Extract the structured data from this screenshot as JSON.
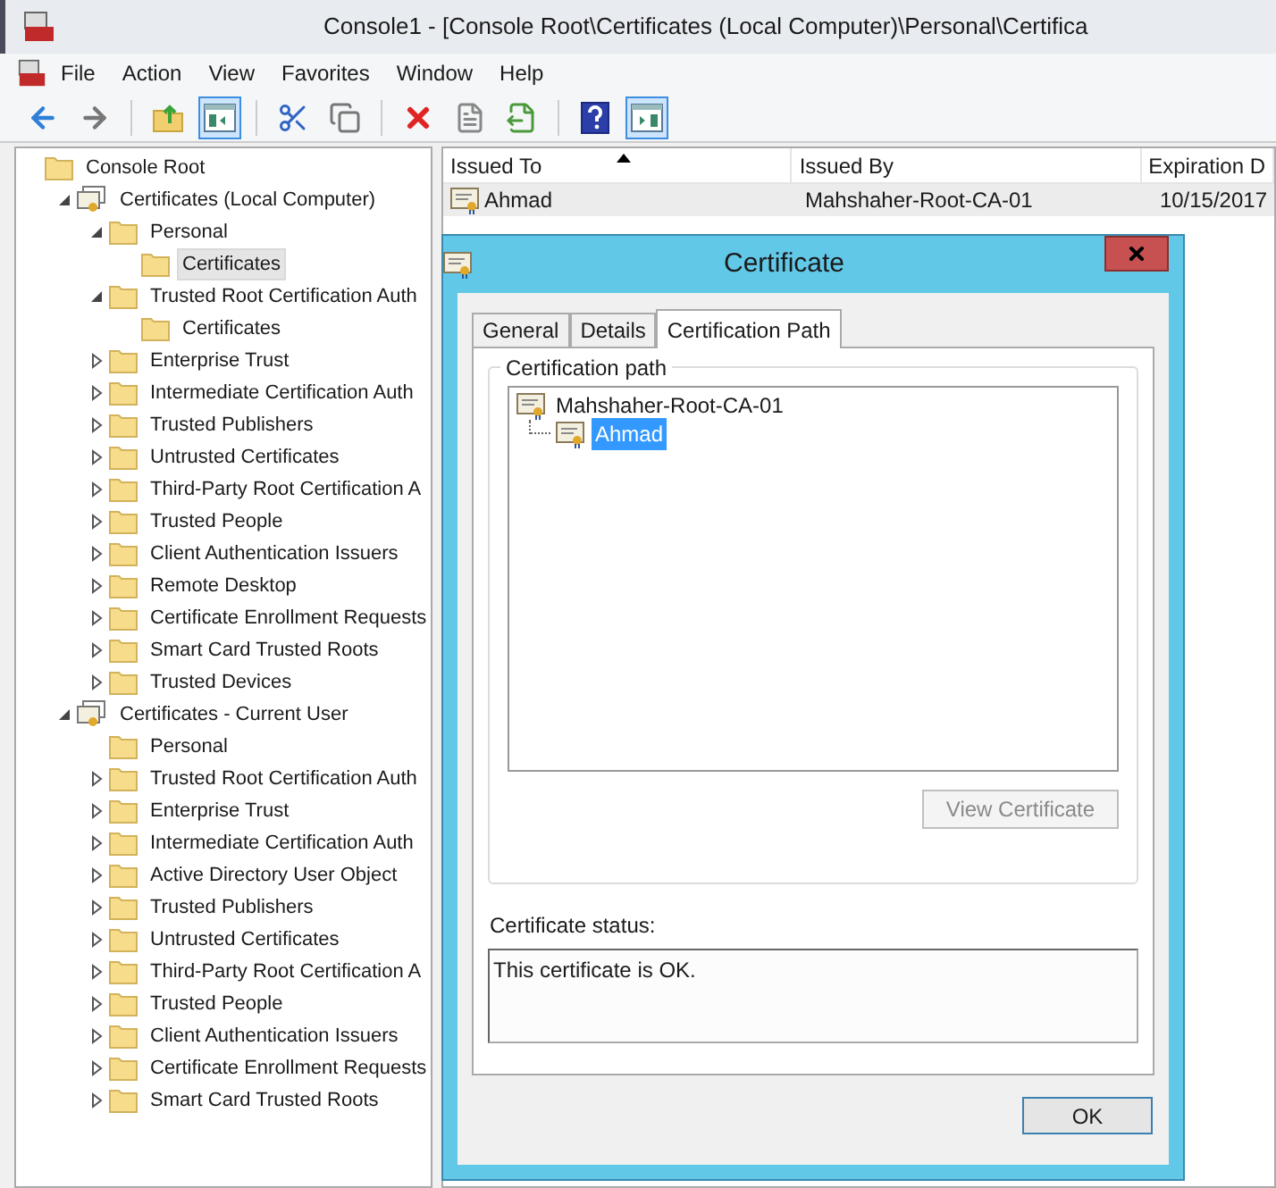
{
  "window": {
    "title": "Console1 - [Console Root\\Certificates (Local Computer)\\Personal\\Certifica"
  },
  "menu": [
    "File",
    "Action",
    "View",
    "Favorites",
    "Window",
    "Help"
  ],
  "toolbar": [
    [
      {
        "kind": "back",
        "pressed": false
      },
      {
        "kind": "forward",
        "pressed": false
      }
    ],
    [
      {
        "kind": "up",
        "pressed": false
      },
      {
        "kind": "tree",
        "pressed": true
      }
    ],
    [
      {
        "kind": "cut",
        "pressed": false
      },
      {
        "kind": "copy",
        "pressed": false
      }
    ],
    [
      {
        "kind": "delete",
        "pressed": false
      },
      {
        "kind": "properties",
        "pressed": false
      },
      {
        "kind": "export",
        "pressed": false
      }
    ],
    [
      {
        "kind": "help",
        "pressed": false
      },
      {
        "kind": "actionpane",
        "pressed": true
      }
    ]
  ],
  "tree": [
    {
      "label": "Console Root",
      "kind": "folder",
      "selected": false,
      "children": [
        {
          "label": "Certificates (Local Computer)",
          "kind": "store",
          "expanded": true,
          "selected": false,
          "children": [
            {
              "label": "Personal",
              "kind": "folder",
              "expanded": true,
              "selected": false,
              "children": [
                {
                  "label": "Certificates",
                  "kind": "folder",
                  "selected": true
                }
              ]
            },
            {
              "label": "Trusted Root Certification Auth",
              "kind": "folder",
              "expanded": true,
              "selected": false,
              "children": [
                {
                  "label": "Certificates",
                  "kind": "folder",
                  "selected": false
                }
              ]
            },
            {
              "label": "Enterprise Trust",
              "kind": "folder",
              "expanded": false,
              "selected": false
            },
            {
              "label": "Intermediate Certification Auth",
              "kind": "folder",
              "expanded": false,
              "selected": false
            },
            {
              "label": "Trusted Publishers",
              "kind": "folder",
              "expanded": false,
              "selected": false
            },
            {
              "label": "Untrusted Certificates",
              "kind": "folder",
              "expanded": false,
              "selected": false
            },
            {
              "label": "Third-Party Root Certification A",
              "kind": "folder",
              "expanded": false,
              "selected": false
            },
            {
              "label": "Trusted People",
              "kind": "folder",
              "expanded": false,
              "selected": false
            },
            {
              "label": "Client Authentication Issuers",
              "kind": "folder",
              "expanded": false,
              "selected": false
            },
            {
              "label": "Remote Desktop",
              "kind": "folder",
              "expanded": false,
              "selected": false
            },
            {
              "label": "Certificate Enrollment Requests",
              "kind": "folder",
              "expanded": false,
              "selected": false
            },
            {
              "label": "Smart Card Trusted Roots",
              "kind": "folder",
              "expanded": false,
              "selected": false
            },
            {
              "label": "Trusted Devices",
              "kind": "folder",
              "expanded": false,
              "selected": false
            }
          ]
        },
        {
          "label": "Certificates - Current User",
          "kind": "store",
          "expanded": true,
          "selected": false,
          "children": [
            {
              "label": "Personal",
              "kind": "folder",
              "selected": false
            },
            {
              "label": "Trusted Root Certification Auth",
              "kind": "folder",
              "expanded": false,
              "selected": false
            },
            {
              "label": "Enterprise Trust",
              "kind": "folder",
              "expanded": false,
              "selected": false
            },
            {
              "label": "Intermediate Certification Auth",
              "kind": "folder",
              "expanded": false,
              "selected": false
            },
            {
              "label": "Active Directory User Object",
              "kind": "folder",
              "expanded": false,
              "selected": false
            },
            {
              "label": "Trusted Publishers",
              "kind": "folder",
              "expanded": false,
              "selected": false
            },
            {
              "label": "Untrusted Certificates",
              "kind": "folder",
              "expanded": false,
              "selected": false
            },
            {
              "label": "Third-Party Root Certification A",
              "kind": "folder",
              "expanded": false,
              "selected": false
            },
            {
              "label": "Trusted People",
              "kind": "folder",
              "expanded": false,
              "selected": false
            },
            {
              "label": "Client Authentication Issuers",
              "kind": "folder",
              "expanded": false,
              "selected": false
            },
            {
              "label": "Certificate Enrollment Requests",
              "kind": "folder",
              "expanded": false,
              "selected": false
            },
            {
              "label": "Smart Card Trusted Roots",
              "kind": "folder",
              "expanded": false,
              "selected": false
            }
          ]
        }
      ]
    }
  ],
  "table": {
    "columns": [
      {
        "label": "Issued To",
        "sorted": true
      },
      {
        "label": "Issued By",
        "sorted": false
      },
      {
        "label": "Expiration D",
        "sorted": false
      }
    ],
    "rows": [
      {
        "cells": [
          "Ahmad",
          "Mahshaher-Root-CA-01",
          "10/15/2017"
        ],
        "selected": true
      }
    ]
  },
  "dialog": {
    "title": "Certificate",
    "tabs": [
      {
        "label": "General",
        "selected": false
      },
      {
        "label": "Details",
        "selected": false
      },
      {
        "label": "Certification Path",
        "selected": true
      }
    ],
    "group_label": "Certification path",
    "path": [
      {
        "label": "Mahshaher-Root-CA-01",
        "selected": false,
        "children": [
          {
            "label": "Ahmad",
            "selected": true
          }
        ]
      }
    ],
    "view_button": {
      "label": "View Certificate",
      "disabled": true
    },
    "status_label": "Certificate status:",
    "status_text": "This certificate is OK.",
    "ok_button": "OK"
  }
}
